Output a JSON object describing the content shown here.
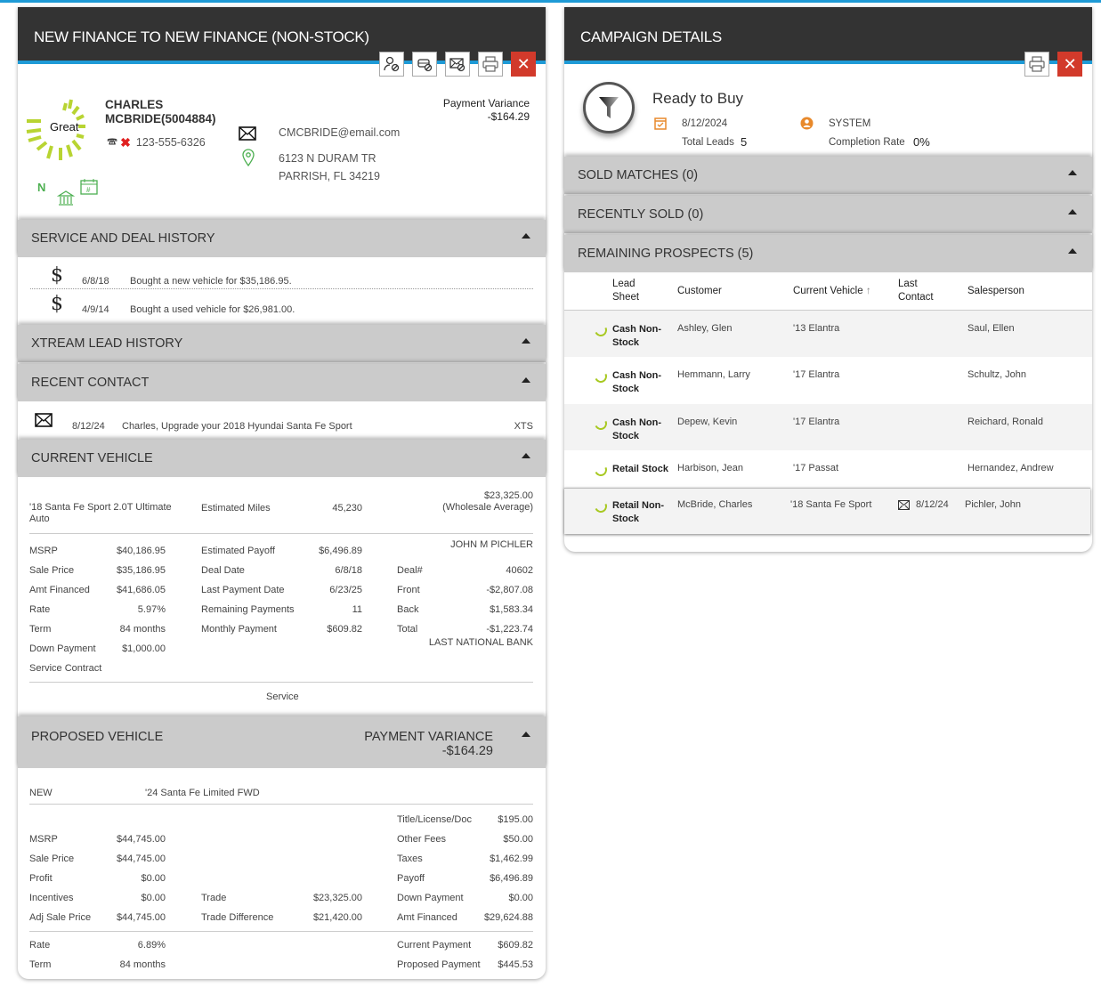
{
  "left_panel": {
    "title": "NEW FINANCE TO NEW FINANCE (NON-STOCK)",
    "toolbar": [
      "person-blocked-icon",
      "car-blocked-icon",
      "email-blocked-icon",
      "printer-icon",
      "close-icon"
    ],
    "close_label": "✕",
    "customer": {
      "rating": "Great",
      "name_line1": "CHARLES",
      "name_line2": "MCBRIDE(5004884)",
      "phone": "123-555-6326",
      "email": "CMCBRIDE@email.com",
      "address1": "6123 N DURAM TR",
      "address2": "PARRISH, FL 34219",
      "badge_n": "N",
      "payment_variance_label": "Payment Variance",
      "payment_variance_value": "-$164.29"
    },
    "service_history": {
      "title": "SERVICE AND DEAL HISTORY",
      "items": [
        {
          "date": "6/8/18",
          "text": "Bought a new vehicle for $35,186.95."
        },
        {
          "date": "4/9/14",
          "text": "Bought a used vehicle for $26,981.00."
        }
      ]
    },
    "xtream": {
      "title": "XTREAM LEAD HISTORY"
    },
    "recent_contact": {
      "title": "RECENT CONTACT",
      "items": [
        {
          "date": "8/12/24",
          "text": "Charles, Upgrade your 2018 Hyundai Santa Fe Sport",
          "source": "XTS"
        }
      ]
    },
    "current_vehicle": {
      "title": "CURRENT VEHICLE",
      "vehicle": "'18 Santa Fe Sport 2.0T Ultimate Auto",
      "est_miles_label": "Estimated Miles",
      "est_miles": "45,230",
      "wholesale_value": "$23,325.00",
      "wholesale_label": "(Wholesale Average)",
      "col1": [
        [
          "MSRP",
          "$40,186.95"
        ],
        [
          "Sale Price",
          "$35,186.95"
        ],
        [
          "Amt Financed",
          "$41,686.05"
        ],
        [
          "Rate",
          "5.97%"
        ],
        [
          "Term",
          "84 months"
        ],
        [
          "Down Payment",
          "$1,000.00"
        ]
      ],
      "col2": [
        [
          "Estimated Payoff",
          "$6,496.89"
        ],
        [
          "Deal Date",
          "6/8/18"
        ],
        [
          "Last Payment Date",
          "6/23/25"
        ],
        [
          "Remaining Payments",
          "11"
        ],
        [
          "Monthly Payment",
          "$609.82"
        ]
      ],
      "salesperson": "JOHN M PICHLER",
      "col3": [
        [
          "Deal#",
          "40602"
        ],
        [
          "Front",
          "-$2,807.08"
        ],
        [
          "Back",
          "$1,583.34"
        ],
        [
          "Total",
          "-$1,223.74"
        ]
      ],
      "bank": "LAST NATIONAL BANK",
      "service_contract": "Service Contract",
      "service": "Service"
    },
    "proposed_vehicle": {
      "title": "PROPOSED VEHICLE",
      "pv_label": "PAYMENT VARIANCE",
      "pv_value": "-$164.29",
      "condition": "NEW",
      "vehicle": "'24 Santa Fe Limited FWD",
      "col1": [
        [
          "MSRP",
          "$44,745.00"
        ],
        [
          "Sale Price",
          "$44,745.00"
        ],
        [
          "Profit",
          "$0.00"
        ],
        [
          "Incentives",
          "$0.00"
        ],
        [
          "Adj Sale Price",
          "$44,745.00"
        ]
      ],
      "col2": [
        [
          "Trade",
          "$23,325.00"
        ],
        [
          "Trade Difference",
          "$21,420.00"
        ]
      ],
      "col3": [
        [
          "Title/License/Doc",
          "$195.00"
        ],
        [
          "Other Fees",
          "$50.00"
        ],
        [
          "Taxes",
          "$1,462.99"
        ],
        [
          "Payoff",
          "$6,496.89"
        ],
        [
          "Down Payment",
          "$0.00"
        ],
        [
          "Amt Financed",
          "$29,624.88"
        ]
      ],
      "rate_label": "Rate",
      "rate": "6.89%",
      "term_label": "Term",
      "term": "84 months",
      "current_payment_label": "Current Payment",
      "current_payment": "$609.82",
      "proposed_payment_label": "Proposed Payment",
      "proposed_payment": "$445.53"
    }
  },
  "right_panel": {
    "title": "CAMPAIGN DETAILS",
    "close_label": "✕",
    "campaign": {
      "name": "Ready to Buy",
      "date": "8/12/2024",
      "owner": "SYSTEM",
      "total_leads_label": "Total Leads",
      "total_leads": "5",
      "completion_label": "Completion Rate",
      "completion": "0%"
    },
    "sections": [
      {
        "title": "SOLD MATCHES (0)"
      },
      {
        "title": "RECENTLY SOLD (0)"
      },
      {
        "title": "REMAINING PROSPECTS (5)"
      }
    ],
    "table": {
      "headers": [
        "Lead Sheet",
        "Customer",
        "Current Vehicle",
        "Last Contact",
        "Salesperson"
      ],
      "rows": [
        {
          "lead": "Cash Non-Stock",
          "customer": "Ashley, Glen",
          "vehicle": "'13 Elantra",
          "contact": "",
          "sales": "Saul, Ellen"
        },
        {
          "lead": "Cash Non-Stock",
          "customer": "Hemmann, Larry",
          "vehicle": "'17 Elantra",
          "contact": "",
          "sales": "Schultz, John"
        },
        {
          "lead": "Cash Non-Stock",
          "customer": "Depew, Kevin",
          "vehicle": "'17 Elantra",
          "contact": "",
          "sales": "Reichard, Ronald"
        },
        {
          "lead": "Retail Stock",
          "customer": "Harbison, Jean",
          "vehicle": "'17 Passat",
          "contact": "",
          "sales": "Hernandez, Andrew"
        },
        {
          "lead": "Retail Non-Stock",
          "customer": "McBride, Charles",
          "vehicle": "'18 Santa Fe Sport",
          "contact": "8/12/24",
          "sales": "Pichler, John"
        }
      ]
    }
  },
  "colors": {
    "accent": "#1e9ad6",
    "header": "#333333",
    "close": "#d23a2b",
    "green": "#4caf50",
    "lime": "#a8c922",
    "orange": "#e8892b"
  }
}
